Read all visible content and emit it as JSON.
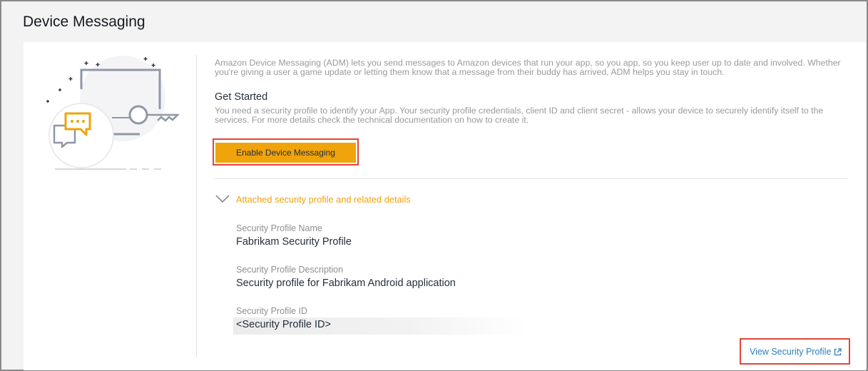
{
  "page": {
    "title": "Device Messaging"
  },
  "intro_text": "Amazon Device Messaging (ADM) lets you send messages to Amazon devices that run your app, so you app, so you keep user up to date and involved. Whether you're giving a user a game update or letting them know that a message from their buddy has arrived, ADM helps you stay in touch.",
  "get_started": {
    "title": "Get Started",
    "text": "You need a security profile to identify your App. Your security profile credentials, client ID and client secret - allows your device to securely identify itself to the services. For more details check the technical documentation on how to create it.",
    "button_label": "Enable Device Messaging"
  },
  "accordion": {
    "label": "Attached security profile and related details"
  },
  "fields": {
    "name_label": "Security Profile Name",
    "name_value": "Fabrikam Security Profile",
    "desc_label": "Security Profile Description",
    "desc_value": "Security profile for Fabrikam Android application",
    "id_label": "Security Profile ID",
    "id_value": "<Security Profile ID>"
  },
  "link": {
    "label": "View Security Profile"
  },
  "colors": {
    "accent": "#f0a30a",
    "link": "#2a7fc1",
    "highlight": "#e0463a"
  },
  "icons": [
    "illustration-chat-key",
    "chevron-down-icon",
    "external-link-icon"
  ]
}
